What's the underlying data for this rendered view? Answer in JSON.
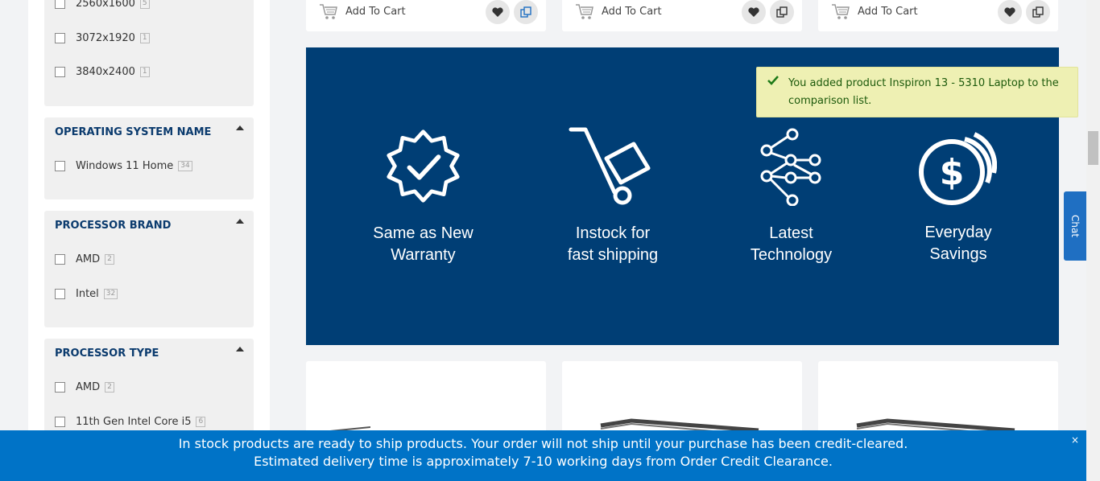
{
  "filters": {
    "resolution": {
      "options": [
        {
          "label": "2560x1600",
          "count": "5"
        },
        {
          "label": "3072x1920",
          "count": "1"
        },
        {
          "label": "3840x2400",
          "count": "1"
        }
      ]
    },
    "os": {
      "title": "OPERATING SYSTEM NAME",
      "options": [
        {
          "label": "Windows 11 Home",
          "count": "34"
        }
      ]
    },
    "processor_brand": {
      "title": "PROCESSOR BRAND",
      "options": [
        {
          "label": "AMD",
          "count": "2"
        },
        {
          "label": "Intel",
          "count": "32"
        }
      ]
    },
    "processor_type": {
      "title": "PROCESSOR TYPE",
      "options": [
        {
          "label": "AMD",
          "count": "2"
        },
        {
          "label": "11th Gen Intel Core i5",
          "count": "6"
        }
      ]
    }
  },
  "products": {
    "add_to_cart_label": "Add To Cart"
  },
  "banner": {
    "features": [
      {
        "line1": "Same as New",
        "line2": "Warranty",
        "icon": "badge-check-icon"
      },
      {
        "line1": "Instock for",
        "line2": "fast shipping",
        "icon": "hand-truck-icon"
      },
      {
        "line1": "Latest",
        "line2": "Technology",
        "icon": "network-icon"
      },
      {
        "line1": "Everyday",
        "line2": "Savings",
        "icon": "dollar-coins-icon"
      }
    ],
    "background": "#003e75"
  },
  "toast": {
    "message": "You added product Inspiron 13 - 5310 Laptop to the comparison list."
  },
  "chat": {
    "label": "Chat"
  },
  "notice": {
    "line1": "In stock products are ready to ship products. Your order will not ship until your purchase has been credit-cleared.",
    "line2": "Estimated delivery time is approximately 7-10 working days from Order Credit Clearance.",
    "close": "×"
  }
}
